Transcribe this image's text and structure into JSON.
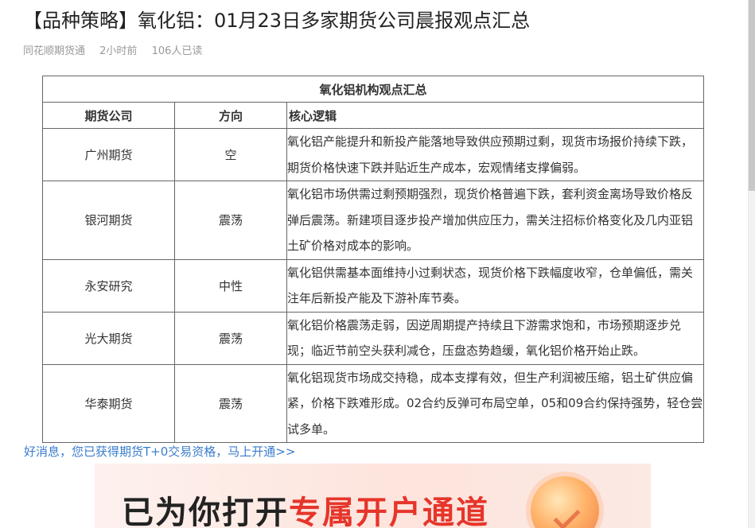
{
  "article": {
    "title": "【品种策略】氧化铝：01月23日多家期货公司晨报观点汇总",
    "source": "同花顺期货通",
    "time": "2小时前",
    "reads": "106人已读"
  },
  "table": {
    "title": "氧化铝机构观点汇总",
    "headers": [
      "期货公司",
      "方向",
      "核心逻辑"
    ],
    "rows": [
      {
        "company": "广州期货",
        "direction": "空",
        "logic": "氧化铝产能提升和新投产能落地导致供应预期过剩，现货市场报价持续下跌，期货价格快速下跌并贴近生产成本，宏观情绪支撑偏弱。"
      },
      {
        "company": "银河期货",
        "direction": "震荡",
        "logic": "氧化铝市场供需过剩预期强烈，现货价格普遍下跌，套利资金离场导致价格反弹后震荡。新建项目逐步投产增加供应压力，需关注招标价格变化及几内亚铝土矿价格对成本的影响。"
      },
      {
        "company": "永安研究",
        "direction": "中性",
        "logic": "氧化铝供需基本面维持小过剩状态，现货价格下跌幅度收窄，仓单偏低，需关注年后新投产能及下游补库节奏。"
      },
      {
        "company": "光大期货",
        "direction": "震荡",
        "logic": "氧化铝价格震荡走弱，因逆周期提产持续且下游需求饱和，市场预期逐步兑现；临近节前空头获利减仓，压盘态势趋缓，氧化铝价格开始止跌。"
      },
      {
        "company": "华泰期货",
        "direction": "震荡",
        "logic": "氧化铝现货市场成交持稳，成本支撑有效，但生产利润被压缩，铝土矿供应偏紧，价格下跌难形成。02合约反弹可布局空单，05和09合约保持强势，轻仓尝试多单。"
      }
    ]
  },
  "promo": {
    "link_text": "好消息，您已获得期货T+0交易资格，马上开通>>",
    "banner_text_dark": "已为你打开",
    "banner_text_red": "专属开户通道"
  },
  "colors": {
    "link": "#3a7ccc",
    "banner_red": "#e6352b",
    "meta_gray": "#999999",
    "table_border": "#666666"
  }
}
